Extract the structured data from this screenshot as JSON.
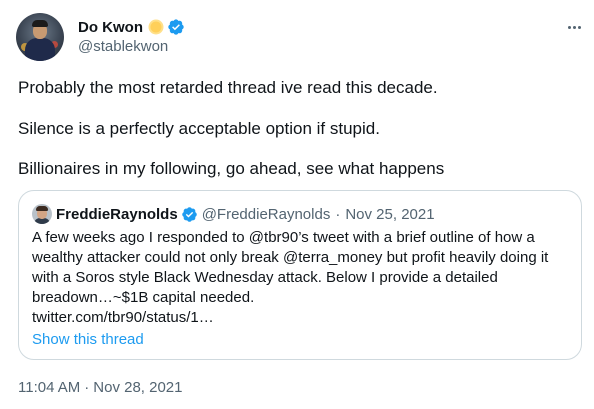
{
  "author": {
    "display_name": "Do Kwon",
    "handle": "@stablekwon",
    "verified": true
  },
  "tweet": {
    "paragraphs": [
      "Probably the most retarded thread ive read this decade.",
      "Silence is a perfectly acceptable option if stupid.",
      "Billionaires in my following, go ahead, see what happens"
    ],
    "time": "11:04 AM",
    "separator": "·",
    "date": "Nov 28, 2021"
  },
  "quoted_tweet": {
    "display_name": "FreddieRaynolds",
    "handle": "@FreddieRaynolds",
    "separator": "·",
    "date": "Nov 25, 2021",
    "verified": true,
    "body_lines": [
      "A few weeks ago I responded to @tbr90’s tweet with a brief outline of how a",
      "wealthy attacker could not only break @terra_money but profit heavily doing it",
      "with a Soros style Black Wednesday attack. Below I provide a detailed",
      "breadown…~$1B capital needed.",
      "twitter.com/tbr90/status/1…"
    ],
    "show_thread_label": "Show this thread"
  },
  "icons": {
    "name_emoji": "sun-icon",
    "verified": "verified-badge-icon",
    "more": "more-options-icon"
  },
  "colors": {
    "text": "#0f1419",
    "secondary": "#536471",
    "link": "#1d9bf0",
    "verified": "#1d9bf0",
    "border": "#cfd9de",
    "sun": "#ffd05a"
  }
}
